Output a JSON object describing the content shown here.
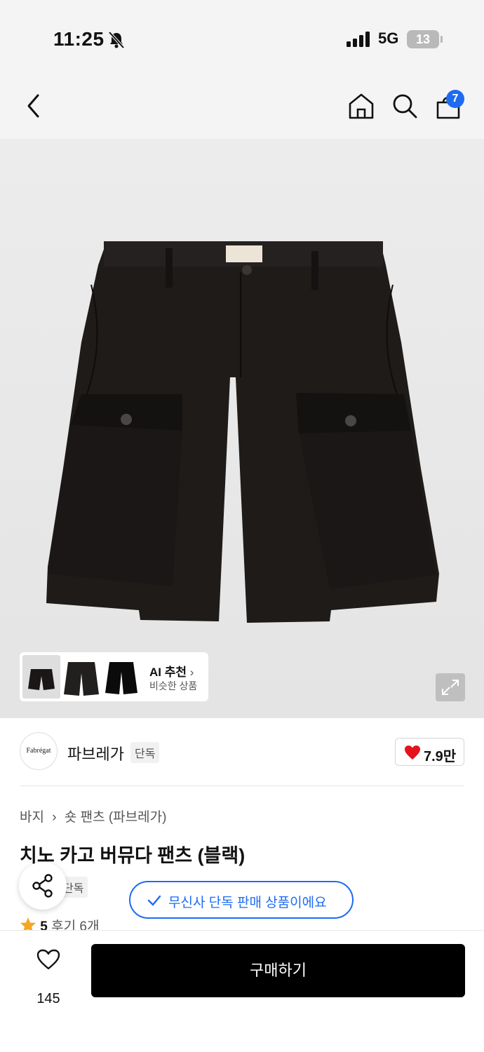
{
  "status_bar": {
    "time": "11:25",
    "network": "5G",
    "battery": "13"
  },
  "nav": {
    "cart_count": "7"
  },
  "gallery": {
    "ai_title": "AI 추천",
    "ai_subtitle": "비슷한 상품"
  },
  "brand": {
    "logo_text": "Fabrégat",
    "name": "파브레가",
    "tag": "단독",
    "likes": "7.9만"
  },
  "product": {
    "breadcrumb": [
      "바지",
      "숏 팬츠 (파브레가)"
    ],
    "title": "치노 카고 버뮤다 팬츠 (블랙)",
    "tag": "단독",
    "rating": "5",
    "reviews": "후기 6개"
  },
  "toast": {
    "text": "무신사 단독 판매 상품이에요"
  },
  "bottom": {
    "like_count": "145",
    "buy_label": "구매하기"
  },
  "colors": {
    "accent": "#1e6bf2",
    "heart": "#e5121c",
    "star": "#f5a623"
  }
}
